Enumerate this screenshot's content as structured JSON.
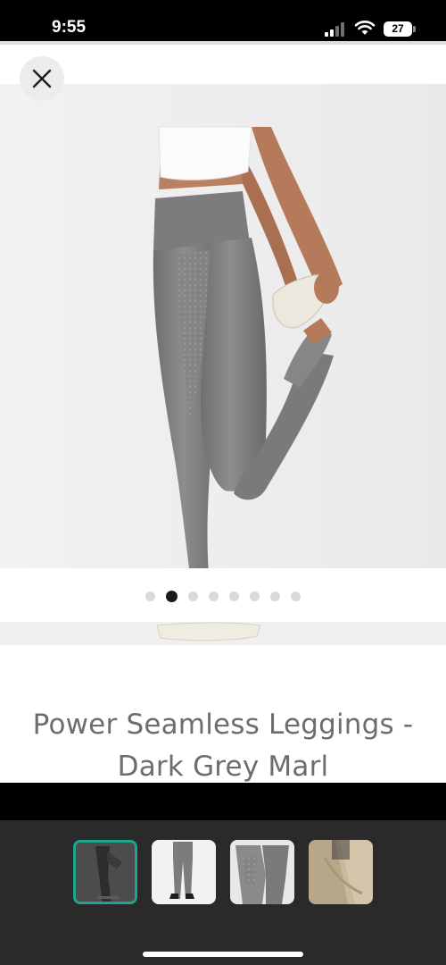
{
  "status_bar": {
    "time": "9:55",
    "battery": "27",
    "icons": [
      "signal-icon",
      "wifi-icon",
      "battery-icon"
    ]
  },
  "header": {
    "close_icon": "close-icon"
  },
  "carousel": {
    "total_images": 8,
    "active_index": 1
  },
  "product": {
    "title": "Power Seamless Leggings - Dark Grey Marl"
  },
  "thumbnails": {
    "count": 4,
    "selected_index": 0,
    "accent_color": "#1fa58c"
  },
  "colors": {
    "background": "#ffffff",
    "title_text": "#6d6d6d",
    "tray": "#2a2a2a"
  }
}
